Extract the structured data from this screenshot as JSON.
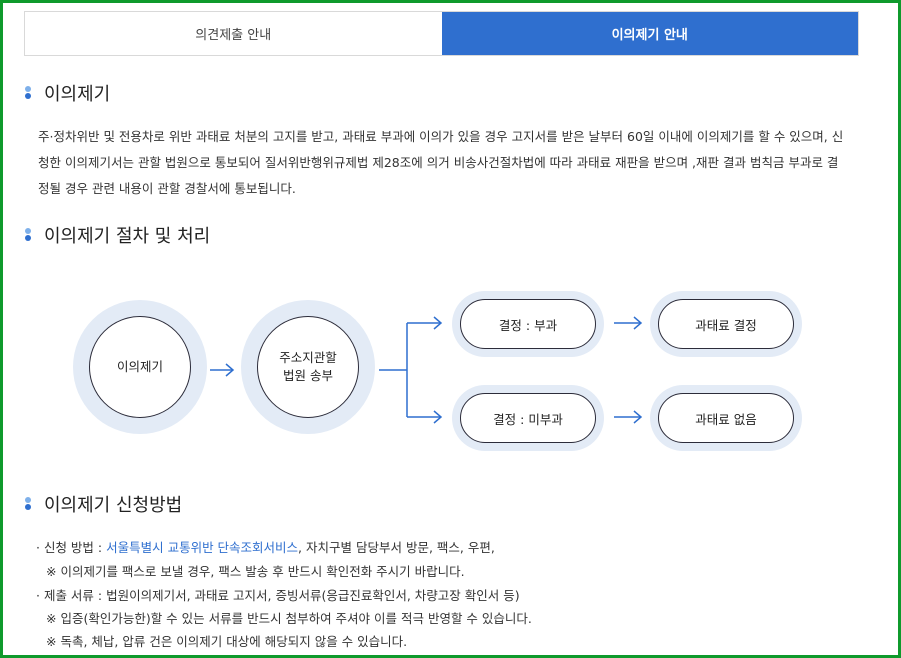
{
  "tabs": [
    {
      "label": "의견제출 안내",
      "active": false
    },
    {
      "label": "이의제기 안내",
      "active": true
    }
  ],
  "section1": {
    "title": "이의제기",
    "body": "주·정차위반 및 전용차로 위반 과태료 처분의 고지를 받고, 과태료 부과에 이의가 있을 경우 고지서를 받은 날부터 60일 이내에 이의제기를 할 수 있으며, 신청한 이의제기서는 관할 법원으로 통보되어 질서위반행위규제법 제28조에 의거 비송사건절차법에 따라 과태료 재판을 받으며 ,재판 결과 범칙금 부과로 결정될 경우 관련 내용이 관할 경찰서에 통보됩니다."
  },
  "section2": {
    "title": "이의제기 절차 및 처리",
    "flow": {
      "step1": "이의제기",
      "step2_line1": "주소지관할",
      "step2_line2": "법원 송부",
      "decision_a": "결정 : 부과",
      "decision_b": "결정 : 미부과",
      "result_a": "과태료 결정",
      "result_b": "과태료 없음"
    }
  },
  "section3": {
    "title": "이의제기 신청방법",
    "item1_prefix": "· 신청 방법 : ",
    "item1_link": "서울특별시 교통위반 단속조회서비스",
    "item1_suffix": ", 자치구별 담당부서 방문, 팩스, 우편,",
    "item1_note": "※ 이의제기를 팩스로 보낼 경우, 팩스 발송 후 반드시 확인전화 주시기 바랍니다.",
    "item2": "· 제출 서류 : 법원이의제기서, 과태료 고지서, 증빙서류(응급진료확인서, 차량고장 확인서 등)",
    "item2_note1": "※ 입증(확인가능한)할 수 있는 서류를 반드시 첨부하여 주셔야 이를 적극 반영할 수 있습니다.",
    "item2_note2": "※ 독촉, 체납, 압류 건은 이의제기 대상에 해당되지 않을 수 있습니다."
  },
  "colors": {
    "accent": "#2f6fcf",
    "border": "#0f9a2c",
    "halo": "#e3ebf6"
  }
}
